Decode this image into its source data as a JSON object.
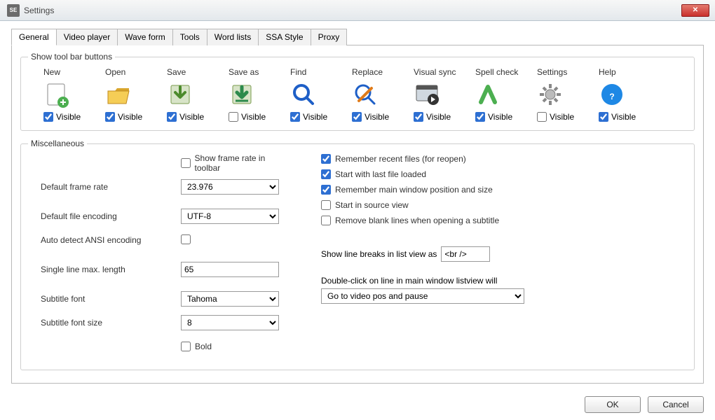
{
  "window": {
    "title": "Settings"
  },
  "tabs": [
    "General",
    "Video player",
    "Wave form",
    "Tools",
    "Word lists",
    "SSA Style",
    "Proxy"
  ],
  "active_tab": 0,
  "groupbox1_title": "Show tool bar buttons",
  "visible_label": "Visible",
  "toolbar_items": [
    {
      "label": "New",
      "visible": true
    },
    {
      "label": "Open",
      "visible": true
    },
    {
      "label": "Save",
      "visible": true
    },
    {
      "label": "Save as",
      "visible": false
    },
    {
      "label": "Find",
      "visible": true
    },
    {
      "label": "Replace",
      "visible": true
    },
    {
      "label": "Visual sync",
      "visible": true
    },
    {
      "label": "Spell check",
      "visible": true
    },
    {
      "label": "Settings",
      "visible": false
    },
    {
      "label": "Help",
      "visible": true
    }
  ],
  "groupbox2_title": "Miscellaneous",
  "misc": {
    "show_frame_rate_label": "Show frame rate in toolbar",
    "show_frame_rate": false,
    "default_frame_rate_label": "Default frame rate",
    "default_frame_rate": "23.976",
    "default_file_encoding_label": "Default file encoding",
    "default_file_encoding": "UTF-8",
    "auto_detect_ansi_label": "Auto detect ANSI encoding",
    "auto_detect_ansi": false,
    "single_line_max_label": "Single line max. length",
    "single_line_max": "65",
    "subtitle_font_label": "Subtitle font",
    "subtitle_font": "Tahoma",
    "subtitle_font_size_label": "Subtitle font size",
    "subtitle_font_size": "8",
    "bold_label": "Bold",
    "bold": false,
    "remember_recent_label": "Remember recent files (for reopen)",
    "remember_recent": true,
    "start_last_file_label": "Start with last file loaded",
    "start_last_file": true,
    "remember_window_label": "Remember main window position and size",
    "remember_window": true,
    "start_source_view_label": "Start in source view",
    "start_source_view": false,
    "remove_blank_lines_label": "Remove blank lines when opening a subtitle",
    "remove_blank_lines": false,
    "show_line_breaks_label": "Show line breaks in list view as",
    "show_line_breaks_value": "<br />",
    "double_click_label": "Double-click on line in main window listview will",
    "double_click_value": "Go to video pos and pause"
  },
  "buttons": {
    "ok": "OK",
    "cancel": "Cancel"
  }
}
